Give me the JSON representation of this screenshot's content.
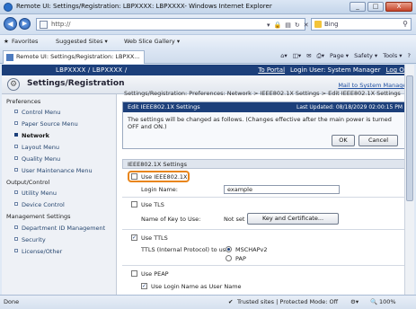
{
  "window": {
    "title": "Remote UI: Settings/Registration: LBPXXXX: LBPXXXX- Windows Internet Explorer",
    "buttons": [
      "_",
      "□",
      "X"
    ]
  },
  "browser": {
    "url": "http://",
    "search_placeholder": "Bing",
    "favorites_label": "Favorites",
    "suggested_sites": "Suggested Sites ▾",
    "web_slice_gallery": "Web Slice Gallery ▾",
    "tab_title": "Remote UI: Settings/Registration: LBPXX...",
    "commands": [
      "Page ▾",
      "Safety ▾",
      "Tools ▾"
    ]
  },
  "page": {
    "device_name": "LBPXXXX / LBPXXXX /",
    "top_links": [
      "To Portal",
      "Login User: System Manager",
      "Log Out"
    ],
    "header_title": "Settings/Registration",
    "mail_link": "Mail to System Manager",
    "breadcrumb": "Settings/Registration: Preferences: Network > IEEE802.1X Settings > Edit IEEE802.1X Settings",
    "sidebar": {
      "preferences": "Preferences",
      "preferences_items": [
        "Control Menu",
        "Paper Source Menu",
        "Network",
        "Layout Menu",
        "Quality Menu",
        "User Maintenance Menu"
      ],
      "output_control": "Output/Control",
      "output_items": [
        "Utility Menu",
        "Device Control"
      ],
      "management": "Management Settings",
      "management_items": [
        "Department ID Management",
        "Security",
        "License/Other"
      ]
    },
    "panel": {
      "title": "Edit IEEE802.1X Settings",
      "last_updated": "Last Updated: 08/18/2029 02:00:15 PM",
      "message": "The settings will be changed as follows. (Changes effective after the main power is turned OFF and ON.)",
      "ok": "OK",
      "cancel": "Cancel"
    },
    "settings": {
      "section_title": "IEEE802.1X Settings",
      "use_ieee": "Use IEEE802.1X",
      "login_name_label": "Login Name:",
      "login_name_value": "example",
      "use_tls": "Use TLS",
      "key_label": "Name of Key to Use:",
      "key_value": "Not set",
      "key_button": "Key and Certificate...",
      "use_ttls": "Use TTLS",
      "ttls_label": "TTLS (Internal Protocol) to use:",
      "mschap": "MSCHAPv2",
      "pap": "PAP",
      "use_peap": "Use PEAP",
      "use_login_as_user": "Use Login Name as User Name"
    }
  },
  "status": {
    "left": "Done",
    "zone": "Trusted sites | Protected Mode: Off",
    "zoom": "100%"
  }
}
